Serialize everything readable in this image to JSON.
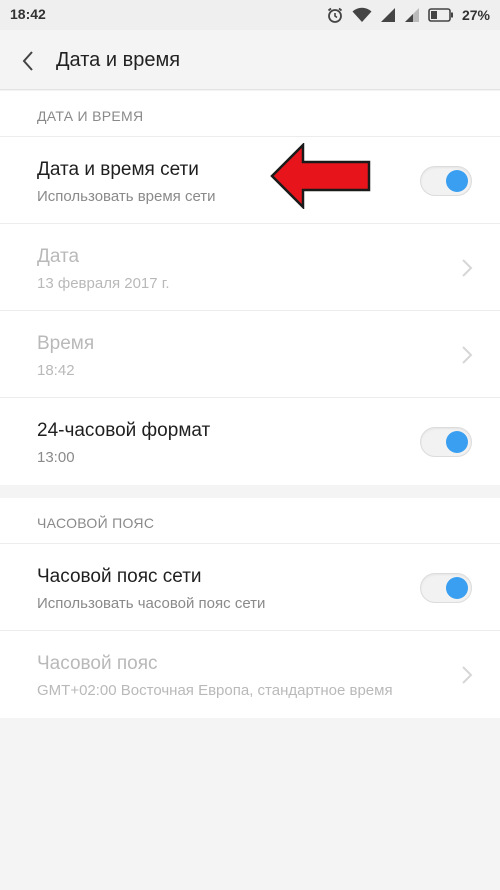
{
  "status": {
    "time": "18:42",
    "battery": "27%",
    "icons": [
      "alarm-icon",
      "wifi-icon",
      "signal-icon",
      "signal-icon",
      "battery-icon"
    ]
  },
  "appbar": {
    "title": "Дата и время",
    "back_icon": "chevron-left-icon"
  },
  "sections": [
    {
      "header": "ДАТА И ВРЕМЯ",
      "rows": [
        {
          "title": "Дата и время сети",
          "subtitle": "Использовать время сети",
          "control": "toggle",
          "on": true,
          "enabled": true
        },
        {
          "title": "Дата",
          "subtitle": "13 февраля 2017 г.",
          "control": "chevron",
          "enabled": false
        },
        {
          "title": "Время",
          "subtitle": "18:42",
          "control": "chevron",
          "enabled": false
        },
        {
          "title": "24-часовой формат",
          "subtitle": "13:00",
          "control": "toggle",
          "on": true,
          "enabled": true
        }
      ]
    },
    {
      "header": "ЧАСОВОЙ ПОЯС",
      "rows": [
        {
          "title": "Часовой пояс сети",
          "subtitle": "Использовать часовой пояс сети",
          "control": "toggle",
          "on": true,
          "enabled": true
        },
        {
          "title": "Часовой пояс",
          "subtitle": "GMT+02:00 Восточная Европа, стандартное время",
          "control": "chevron",
          "enabled": false
        }
      ]
    }
  ],
  "colors": {
    "accent": "#3a9ff0",
    "annotation_arrow": "#e8141c"
  }
}
